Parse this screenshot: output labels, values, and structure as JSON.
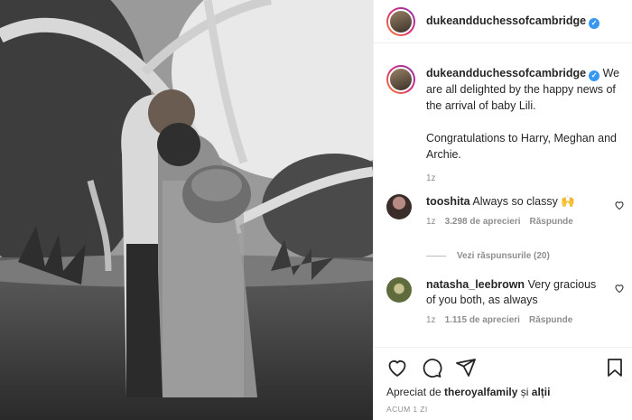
{
  "post": {
    "username": "dukeandduchessofcambridge",
    "caption_line1": "We are all delighted by the happy news of the arrival of baby Lili.",
    "caption_line2": "Congratulations to Harry, Meghan and Archie.",
    "caption_time": "1z"
  },
  "comments": [
    {
      "user": "tooshita",
      "text": "Always so classy 🙌",
      "time": "1z",
      "likes": "3.298 de aprecieri",
      "reply": "Răspunde"
    },
    {
      "user": "natasha_leebrown",
      "text": "Very gracious of you both, as always",
      "time": "1z",
      "likes": "1.115 de aprecieri",
      "reply": "Răspunde"
    }
  ],
  "view_replies": "Vezi răspunsurile (20)",
  "footer": {
    "liked_prefix": "Apreciat de",
    "liked_user": "theroyalfamily",
    "liked_suffix": "și",
    "liked_others": "alții",
    "posted_ago": "ACUM 1 ZI"
  },
  "icons": {
    "like": "heart-icon",
    "comment": "comment-icon",
    "share": "share-icon",
    "save": "bookmark-icon",
    "verified": "verified-badge-icon"
  }
}
